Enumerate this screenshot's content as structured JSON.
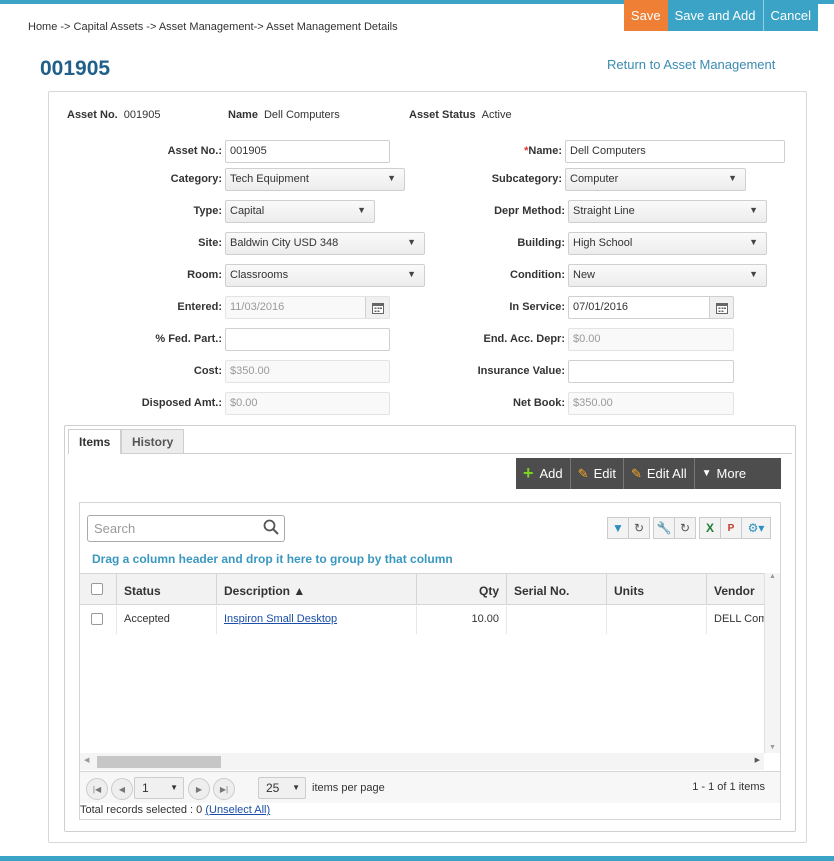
{
  "breadcrumb": "Home -> Capital Assets -> Asset Management-> Asset Management Details",
  "actions": {
    "save": "Save",
    "save_add": "Save and Add",
    "cancel": "Cancel"
  },
  "page_title": "001905",
  "return_link": "Return to Asset Management",
  "summary": {
    "asset_no_label": "Asset No.",
    "asset_no": "001905",
    "name_label": "Name",
    "name": "Dell Computers",
    "status_label": "Asset Status",
    "status": "Active"
  },
  "form": {
    "asset_no": {
      "label": "Asset No.:",
      "value": "001905"
    },
    "name": {
      "req": "*",
      "label": "Name:",
      "value": "Dell Computers"
    },
    "category": {
      "label": "Category:",
      "value": "Tech Equipment"
    },
    "subcategory": {
      "label": "Subcategory:",
      "value": "Computer"
    },
    "type": {
      "label": "Type:",
      "value": "Capital"
    },
    "depr_method": {
      "label": "Depr Method:",
      "value": "Straight Line"
    },
    "site": {
      "label": "Site:",
      "value": "Baldwin City USD 348"
    },
    "building": {
      "label": "Building:",
      "value": "High School"
    },
    "room": {
      "label": "Room:",
      "value": "Classrooms"
    },
    "condition": {
      "label": "Condition:",
      "value": "New"
    },
    "entered": {
      "label": "Entered:",
      "value": "11/03/2016"
    },
    "in_service": {
      "label": "In Service:",
      "value": "07/01/2016"
    },
    "fed_part": {
      "label": "% Fed. Part.:",
      "value": ""
    },
    "end_acc_depr": {
      "label": "End. Acc. Depr:",
      "value": "$0.00"
    },
    "cost": {
      "label": "Cost:",
      "value": "$350.00"
    },
    "insurance": {
      "label": "Insurance Value:",
      "value": ""
    },
    "disposed": {
      "label": "Disposed Amt.:",
      "value": "$0.00"
    },
    "net_book": {
      "label": "Net Book:",
      "value": "$350.00"
    }
  },
  "tabs": [
    {
      "label": "Items"
    },
    {
      "label": "History"
    }
  ],
  "toolbar": {
    "add": "Add",
    "edit": "Edit",
    "edit_all": "Edit All",
    "more": "More"
  },
  "grid": {
    "search_placeholder": "Search",
    "group_hint": "Drag a column header and drop it here to group by that column",
    "columns": [
      "Status",
      "Description ▲",
      "Qty",
      "Serial No.",
      "Units",
      "Vendor"
    ],
    "rows": [
      {
        "status": "Accepted",
        "description": "Inspiron Small Desktop",
        "qty": "10.00",
        "serial": "",
        "units": "",
        "vendor": "DELL Com"
      }
    ]
  },
  "pager": {
    "page": "1",
    "page_size": "25",
    "items_per_page": "items per page",
    "summary": "1 - 1 of 1 items"
  },
  "footer": {
    "selected": "Total records selected : 0",
    "unselect": "(Unselect All)"
  }
}
